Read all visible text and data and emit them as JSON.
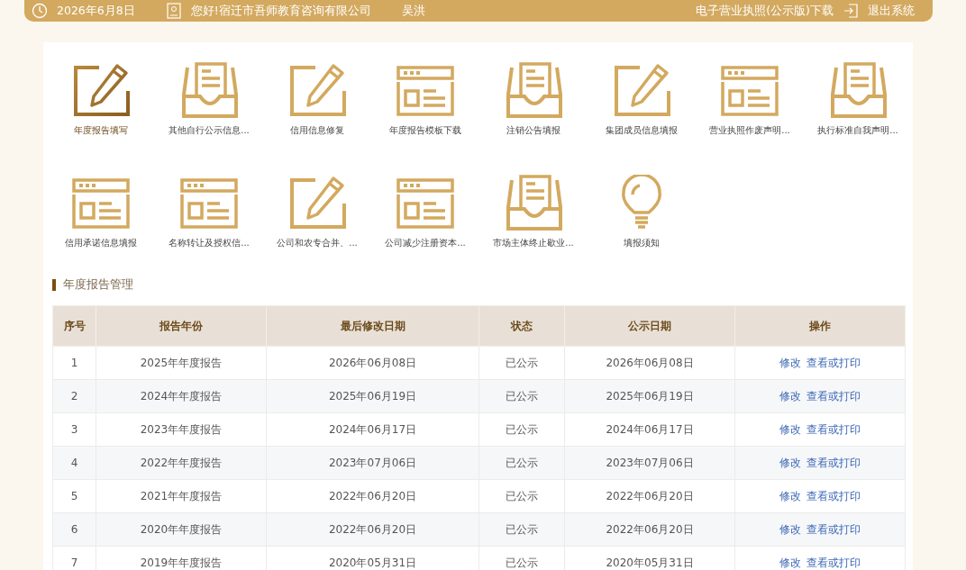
{
  "top_bar": {
    "date": "2026年6月8日",
    "greeting": "您好!宿迁市吾师教育咨询有限公司",
    "user": "吴洪",
    "license_link": "电子营业执照(公示版)下载",
    "logout": "退出系统"
  },
  "shortcuts": [
    {
      "kind": "pencil",
      "label": "年度报告填写",
      "selected": true
    },
    {
      "kind": "tray",
      "label": "其他自行公示信息...",
      "selected": false
    },
    {
      "kind": "pencil",
      "label": "信用信息修复",
      "selected": false
    },
    {
      "kind": "window",
      "label": "年度报告模板下载",
      "selected": false
    },
    {
      "kind": "tray",
      "label": "注销公告填报",
      "selected": false
    },
    {
      "kind": "pencil",
      "label": "集团成员信息填报",
      "selected": false
    },
    {
      "kind": "window",
      "label": "营业执照作废声明...",
      "selected": false
    },
    {
      "kind": "tray",
      "label": "执行标准自我声明...",
      "selected": false
    },
    {
      "kind": "window",
      "label": "信用承诺信息填报",
      "selected": false
    },
    {
      "kind": "window",
      "label": "名称转让及授权信...",
      "selected": false
    },
    {
      "kind": "pencil",
      "label": "公司和农专合并、...",
      "selected": false
    },
    {
      "kind": "window",
      "label": "公司减少注册资本...",
      "selected": false
    },
    {
      "kind": "tray",
      "label": "市场主体终止歇业...",
      "selected": false
    },
    {
      "kind": "bulb",
      "label": "填报须知",
      "selected": false
    }
  ],
  "section_title": "年度报告管理",
  "table": {
    "columns": [
      "序号",
      "报告年份",
      "最后修改日期",
      "状态",
      "公示日期",
      "操作"
    ],
    "rows": [
      {
        "no": "1",
        "year": "2025年年度报告",
        "modified": "2026年06月08日",
        "status": "已公示",
        "published": "2026年06月08日",
        "actions": [
          "修改",
          "查看或打印"
        ]
      },
      {
        "no": "2",
        "year": "2024年年度报告",
        "modified": "2025年06月19日",
        "status": "已公示",
        "published": "2025年06月19日",
        "actions": [
          "修改",
          "查看或打印"
        ]
      },
      {
        "no": "3",
        "year": "2023年年度报告",
        "modified": "2024年06月17日",
        "status": "已公示",
        "published": "2024年06月17日",
        "actions": [
          "修改",
          "查看或打印"
        ]
      },
      {
        "no": "4",
        "year": "2022年年度报告",
        "modified": "2023年07月06日",
        "status": "已公示",
        "published": "2023年07月06日",
        "actions": [
          "修改",
          "查看或打印"
        ]
      },
      {
        "no": "5",
        "year": "2021年年度报告",
        "modified": "2022年06月20日",
        "status": "已公示",
        "published": "2022年06月20日",
        "actions": [
          "修改",
          "查看或打印"
        ]
      },
      {
        "no": "6",
        "year": "2020年年度报告",
        "modified": "2022年06月20日",
        "status": "已公示",
        "published": "2022年06月20日",
        "actions": [
          "修改",
          "查看或打印"
        ]
      },
      {
        "no": "7",
        "year": "2019年年度报告",
        "modified": "2020年05月31日",
        "status": "已公示",
        "published": "2020年05月31日",
        "actions": [
          "修改",
          "查看或打印"
        ]
      }
    ]
  }
}
